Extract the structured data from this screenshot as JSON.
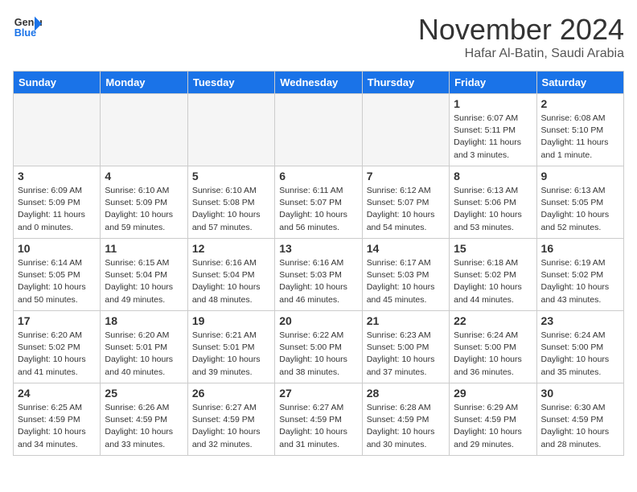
{
  "header": {
    "logo_line1": "General",
    "logo_line2": "Blue",
    "month": "November 2024",
    "location": "Hafar Al-Batin, Saudi Arabia"
  },
  "days_of_week": [
    "Sunday",
    "Monday",
    "Tuesday",
    "Wednesday",
    "Thursday",
    "Friday",
    "Saturday"
  ],
  "weeks": [
    [
      {
        "day": "",
        "empty": true
      },
      {
        "day": "",
        "empty": true
      },
      {
        "day": "",
        "empty": true
      },
      {
        "day": "",
        "empty": true
      },
      {
        "day": "",
        "empty": true
      },
      {
        "day": "1",
        "sunrise": "6:07 AM",
        "sunset": "5:11 PM",
        "daylight": "11 hours and 3 minutes."
      },
      {
        "day": "2",
        "sunrise": "6:08 AM",
        "sunset": "5:10 PM",
        "daylight": "11 hours and 1 minute."
      }
    ],
    [
      {
        "day": "3",
        "sunrise": "6:09 AM",
        "sunset": "5:09 PM",
        "daylight": "11 hours and 0 minutes."
      },
      {
        "day": "4",
        "sunrise": "6:10 AM",
        "sunset": "5:09 PM",
        "daylight": "10 hours and 59 minutes."
      },
      {
        "day": "5",
        "sunrise": "6:10 AM",
        "sunset": "5:08 PM",
        "daylight": "10 hours and 57 minutes."
      },
      {
        "day": "6",
        "sunrise": "6:11 AM",
        "sunset": "5:07 PM",
        "daylight": "10 hours and 56 minutes."
      },
      {
        "day": "7",
        "sunrise": "6:12 AM",
        "sunset": "5:07 PM",
        "daylight": "10 hours and 54 minutes."
      },
      {
        "day": "8",
        "sunrise": "6:13 AM",
        "sunset": "5:06 PM",
        "daylight": "10 hours and 53 minutes."
      },
      {
        "day": "9",
        "sunrise": "6:13 AM",
        "sunset": "5:05 PM",
        "daylight": "10 hours and 52 minutes."
      }
    ],
    [
      {
        "day": "10",
        "sunrise": "6:14 AM",
        "sunset": "5:05 PM",
        "daylight": "10 hours and 50 minutes."
      },
      {
        "day": "11",
        "sunrise": "6:15 AM",
        "sunset": "5:04 PM",
        "daylight": "10 hours and 49 minutes."
      },
      {
        "day": "12",
        "sunrise": "6:16 AM",
        "sunset": "5:04 PM",
        "daylight": "10 hours and 48 minutes."
      },
      {
        "day": "13",
        "sunrise": "6:16 AM",
        "sunset": "5:03 PM",
        "daylight": "10 hours and 46 minutes."
      },
      {
        "day": "14",
        "sunrise": "6:17 AM",
        "sunset": "5:03 PM",
        "daylight": "10 hours and 45 minutes."
      },
      {
        "day": "15",
        "sunrise": "6:18 AM",
        "sunset": "5:02 PM",
        "daylight": "10 hours and 44 minutes."
      },
      {
        "day": "16",
        "sunrise": "6:19 AM",
        "sunset": "5:02 PM",
        "daylight": "10 hours and 43 minutes."
      }
    ],
    [
      {
        "day": "17",
        "sunrise": "6:20 AM",
        "sunset": "5:02 PM",
        "daylight": "10 hours and 41 minutes."
      },
      {
        "day": "18",
        "sunrise": "6:20 AM",
        "sunset": "5:01 PM",
        "daylight": "10 hours and 40 minutes."
      },
      {
        "day": "19",
        "sunrise": "6:21 AM",
        "sunset": "5:01 PM",
        "daylight": "10 hours and 39 minutes."
      },
      {
        "day": "20",
        "sunrise": "6:22 AM",
        "sunset": "5:00 PM",
        "daylight": "10 hours and 38 minutes."
      },
      {
        "day": "21",
        "sunrise": "6:23 AM",
        "sunset": "5:00 PM",
        "daylight": "10 hours and 37 minutes."
      },
      {
        "day": "22",
        "sunrise": "6:24 AM",
        "sunset": "5:00 PM",
        "daylight": "10 hours and 36 minutes."
      },
      {
        "day": "23",
        "sunrise": "6:24 AM",
        "sunset": "5:00 PM",
        "daylight": "10 hours and 35 minutes."
      }
    ],
    [
      {
        "day": "24",
        "sunrise": "6:25 AM",
        "sunset": "4:59 PM",
        "daylight": "10 hours and 34 minutes."
      },
      {
        "day": "25",
        "sunrise": "6:26 AM",
        "sunset": "4:59 PM",
        "daylight": "10 hours and 33 minutes."
      },
      {
        "day": "26",
        "sunrise": "6:27 AM",
        "sunset": "4:59 PM",
        "daylight": "10 hours and 32 minutes."
      },
      {
        "day": "27",
        "sunrise": "6:27 AM",
        "sunset": "4:59 PM",
        "daylight": "10 hours and 31 minutes."
      },
      {
        "day": "28",
        "sunrise": "6:28 AM",
        "sunset": "4:59 PM",
        "daylight": "10 hours and 30 minutes."
      },
      {
        "day": "29",
        "sunrise": "6:29 AM",
        "sunset": "4:59 PM",
        "daylight": "10 hours and 29 minutes."
      },
      {
        "day": "30",
        "sunrise": "6:30 AM",
        "sunset": "4:59 PM",
        "daylight": "10 hours and 28 minutes."
      }
    ]
  ],
  "labels": {
    "sunrise": "Sunrise:",
    "sunset": "Sunset:",
    "daylight": "Daylight:"
  }
}
